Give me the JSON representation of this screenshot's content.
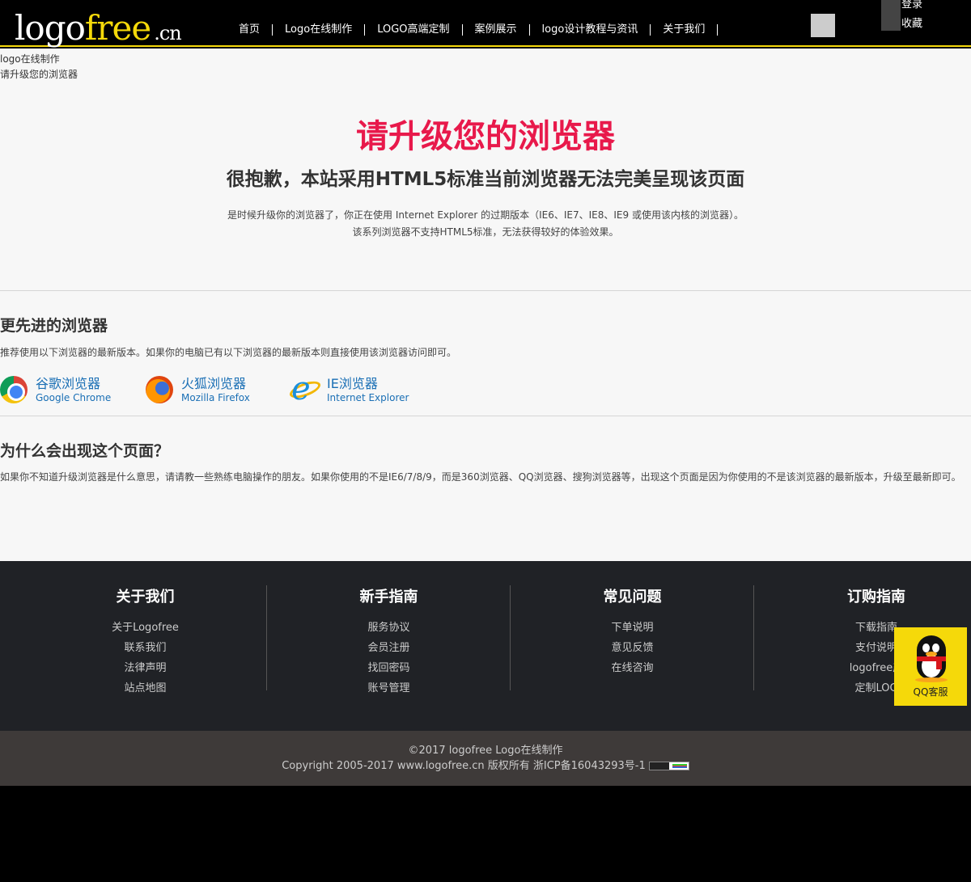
{
  "header": {
    "logo": {
      "part1": "logo",
      "part2": "free",
      "part3": ".cn"
    },
    "nav": [
      "首页",
      "Logo在线制作",
      "LOGO高端定制",
      "案例展示",
      "logo设计教程与资讯",
      "关于我们"
    ],
    "login": "登录",
    "favorite": "收藏"
  },
  "breadcrumb": {
    "line1": "logo在线制作",
    "line2": "请升级您的浏览器"
  },
  "hero": {
    "title": "请升级您的浏览器",
    "subtitle": "很抱歉，本站采用HTML5标准当前浏览器无法完美呈现该页面",
    "p1": "是时候升级你的浏览器了，你正在使用 Internet Explorer 的过期版本（IE6、IE7、IE8、IE9 或使用该内核的浏览器）。",
    "p2": "该系列浏览器不支持HTML5标准，无法获得较好的体验效果。"
  },
  "browsers_section": {
    "title": "更先进的浏览器",
    "desc": "推荐使用以下浏览器的最新版本。如果你的电脑已有以下浏览器的最新版本则直接使用该浏览器访问即可。",
    "items": [
      {
        "name": "谷歌浏览器",
        "en": "Google Chrome",
        "icon": "chrome-icon"
      },
      {
        "name": "火狐浏览器",
        "en": "Mozilla Firefox",
        "icon": "firefox-icon"
      },
      {
        "name": "IE浏览器",
        "en": "Internet Explorer",
        "icon": "ie-icon"
      }
    ]
  },
  "why_section": {
    "title": "为什么会出现这个页面？",
    "desc": "如果你不知道升级浏览器是什么意思，请请教一些熟练电脑操作的朋友。如果你使用的不是IE6/7/8/9，而是360浏览器、QQ浏览器、搜狗浏览器等，出现这个页面是因为你使用的不是该浏览器的最新版本，升级至最新即可。"
  },
  "footer": {
    "columns": [
      {
        "title": "关于我们",
        "links": [
          "关于Logofree",
          "联系我们",
          "法律声明",
          "站点地图"
        ]
      },
      {
        "title": "新手指南",
        "links": [
          "服务协议",
          "会员注册",
          "找回密码",
          "账号管理"
        ]
      },
      {
        "title": "常见问题",
        "links": [
          "下单说明",
          "意见反馈",
          "在线咨询"
        ]
      },
      {
        "title": "订购指南",
        "links": [
          "下载指南",
          "支付说明",
          "logofree产",
          "定制LOG"
        ]
      }
    ],
    "copyright1": "©2017 logofree Logo在线制作",
    "copyright2": "Copyright 2005-2017 www.logofree.cn 版权所有 浙ICP备16043293号-1",
    "badge": "CNZZ"
  },
  "qq_widget": {
    "label": "QQ客服",
    "icon": "qq-penguin-icon"
  },
  "colors": {
    "accent": "#f5d90a",
    "hero_title": "#e8194b",
    "link": "#1a6fb5"
  }
}
